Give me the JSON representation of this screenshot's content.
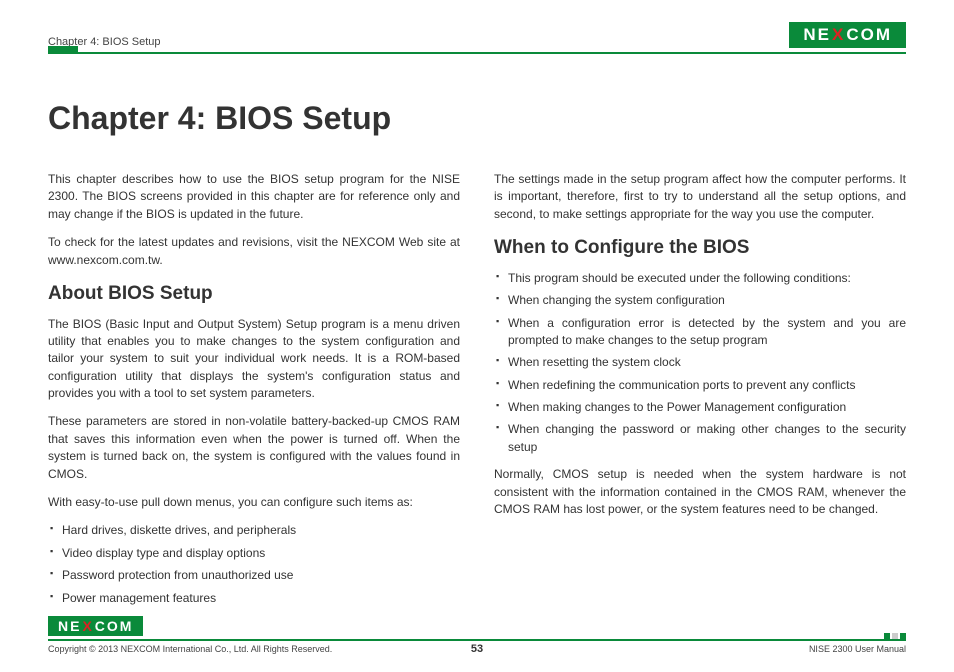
{
  "header": {
    "chapter_label": "Chapter 4: BIOS Setup",
    "logo_text_left": "NE",
    "logo_x": "X",
    "logo_text_right": "COM"
  },
  "title": "Chapter 4: BIOS Setup",
  "left": {
    "intro1": "This chapter describes how to use the BIOS setup program for the NISE 2300. The BIOS screens provided in this chapter are for reference only and may change if the BIOS is updated in the future.",
    "intro2": "To check for the latest updates and revisions, visit the NEXCOM Web site at www.nexcom.com.tw.",
    "about_heading": "About BIOS Setup",
    "about_p1": "The BIOS (Basic Input and Output System) Setup program is a menu driven utility that enables you to make changes to the system configuration and tailor your system to suit your individual work needs. It is a ROM-based configuration utility that displays the system's configuration status and provides you with a tool to set system parameters.",
    "about_p2": "These parameters are stored in non-volatile battery-backed-up CMOS RAM that saves this information even when the power is turned off. When the system is turned back on, the system is configured with the values found in CMOS.",
    "about_p3": "With easy-to-use pull down menus, you can configure such items as:",
    "items": [
      "Hard drives, diskette drives, and peripherals",
      "Video display type and display options",
      "Password protection from unauthorized use",
      "Power management features"
    ]
  },
  "right": {
    "intro": "The settings made in the setup program affect how the computer performs. It is important, therefore, first to try to understand all the setup options, and second, to make settings appropriate for the way you use the computer.",
    "when_heading": "When to Configure the BIOS",
    "items": [
      "This program should be executed under the following conditions:",
      "When changing the system configuration",
      "When a configuration error is detected by the system and you are prompted to make changes to the setup program",
      "When resetting the system clock",
      "When redefining the communication ports to prevent any conflicts",
      "When making changes to the Power Management configuration",
      "When changing the password or making other changes to the security setup"
    ],
    "closing": "Normally, CMOS setup is needed when the system hardware is not consistent with the information contained in the CMOS RAM, whenever the CMOS RAM has lost power, or the system features need to be changed."
  },
  "footer": {
    "copyright": "Copyright © 2013 NEXCOM International Co., Ltd. All Rights Reserved.",
    "page": "53",
    "doc": "NISE 2300 User Manual"
  }
}
